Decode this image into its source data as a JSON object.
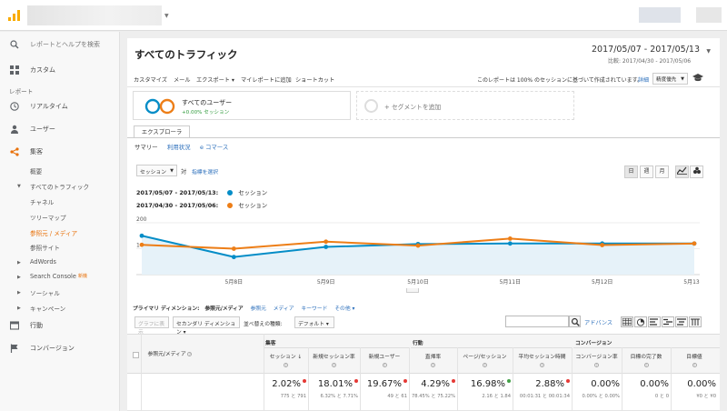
{
  "sidebar": {
    "search": "レポートとヘルプを検索",
    "custom": "カスタム",
    "section": "レポート",
    "items": [
      {
        "label": "リアルタイム"
      },
      {
        "label": "ユーザー"
      },
      {
        "label": "集客"
      }
    ],
    "acquisition_sub": {
      "overview": "概要",
      "all_traffic": "すべてのトラフィック",
      "children": [
        "チャネル",
        "ツリーマップ",
        "参照元 / メディア",
        "参照サイト"
      ],
      "adwords": "AdWords",
      "search_console": "Search Console",
      "search_console_badge": "新機",
      "social": "ソーシャル",
      "campaigns": "キャンペーン"
    },
    "behavior": "行動",
    "conversion": "コンバージョン"
  },
  "header": {
    "title": "すべてのトラフィック",
    "date_range": "2017/05/07 - 2017/05/13",
    "compare": "比較: 2017/04/30 - 2017/05/06"
  },
  "toolbar": {
    "items": [
      "カスタマイズ",
      "メール",
      "エクスポート ▾",
      "マイレポートに追加",
      "ショートカット"
    ],
    "note": "このレポートは 100% のセッションに基づいて作成されています。",
    "detail_link": "詳細",
    "precision": "精度優先"
  },
  "segment": {
    "name": "すべてのユーザー",
    "change": "+0.00% セッション",
    "add": "+ セグメントを追加"
  },
  "explorer": {
    "tab": "エクスプローラ",
    "subnav": [
      "サマリー",
      "利用状況",
      "e コマース"
    ],
    "metric_select": "セッション",
    "vs": "対",
    "select_metric": "指標を選択",
    "granularity": [
      "日",
      "週",
      "月"
    ]
  },
  "legend": [
    {
      "range": "2017/05/07 - 2017/05/13:",
      "label": "セッション"
    },
    {
      "range": "2017/04/30 - 2017/05/06:",
      "label": "セッション"
    }
  ],
  "dimension_bar": {
    "label": "プライマリ ディメンション:",
    "current": "参照元/メディア",
    "options": [
      "参照元",
      "メディア",
      "キーワード",
      "その他 ▾"
    ]
  },
  "table_controls": {
    "plot_rows": "グラフに表示",
    "secondary_dim": "セカンダリ ディメンション ▾",
    "sort_type_label": "並べ替えの種類:",
    "sort_type": "デフォルト ▾",
    "advanced": "アドバンス"
  },
  "table": {
    "dim_header": "参照元/メディア",
    "groups": [
      "集客",
      "行動",
      "コンバージョン"
    ],
    "columns": [
      "セッション",
      "新規セッション率",
      "新規ユーザー",
      "直帰率",
      "ページ/セッション",
      "平均セッション時間",
      "コンバージョン率",
      "目標の完了数",
      "目標値"
    ],
    "totals": [
      {
        "big": "2.02%",
        "small": "775 と 791",
        "dot": "red"
      },
      {
        "big": "18.01%",
        "small": "6.32% と 7.71%",
        "dot": "red"
      },
      {
        "big": "19.67%",
        "small": "49 と 61",
        "dot": "red"
      },
      {
        "big": "4.29%",
        "small": "78.45% と 75.22%",
        "dot": "red"
      },
      {
        "big": "16.98%",
        "small": "2.16 と 1.84",
        "dot": "green"
      },
      {
        "big": "2.88%",
        "small": "00:01:31 と 00:01:34",
        "dot": "red"
      },
      {
        "big": "0.00%",
        "small": "0.00% と 0.00%",
        "dot": ""
      },
      {
        "big": "0.00%",
        "small": "0 と 0",
        "dot": ""
      },
      {
        "big": "0.00%",
        "small": "¥0 と ¥0",
        "dot": ""
      }
    ]
  },
  "chart_data": {
    "type": "line",
    "x": [
      "",
      "5月8日",
      "5月9日",
      "5月10日",
      "5月11日",
      "5月12日",
      "5月13日"
    ],
    "y_ticks": [
      "200",
      "100"
    ],
    "series": [
      {
        "name": "2017/05/07 - 2017/05/13",
        "color": "#058dc7",
        "values": [
          150,
          68,
          107,
          118,
          120,
          120,
          120
        ]
      },
      {
        "name": "2017/04/30 - 2017/05/06",
        "color": "#ed7e17",
        "values": [
          115,
          100,
          127,
          112,
          139,
          114,
          120
        ]
      }
    ],
    "ylim": [
      0,
      200
    ]
  }
}
